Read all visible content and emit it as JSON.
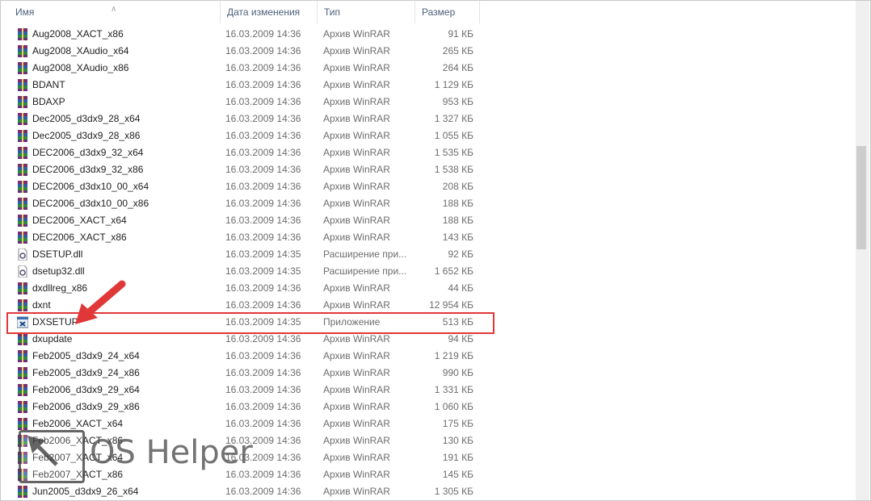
{
  "columns": {
    "name": "Имя",
    "date": "Дата изменения",
    "type": "Тип",
    "size": "Размер"
  },
  "rows": [
    {
      "name": "Aug2008_XACT_x86",
      "date": "16.03.2009 14:36",
      "type": "Архив WinRAR",
      "size": "91 КБ",
      "icon": "winrar-archive-icon"
    },
    {
      "name": "Aug2008_XAudio_x64",
      "date": "16.03.2009 14:36",
      "type": "Архив WinRAR",
      "size": "265 КБ",
      "icon": "winrar-archive-icon"
    },
    {
      "name": "Aug2008_XAudio_x86",
      "date": "16.03.2009 14:36",
      "type": "Архив WinRAR",
      "size": "264 КБ",
      "icon": "winrar-archive-icon"
    },
    {
      "name": "BDANT",
      "date": "16.03.2009 14:36",
      "type": "Архив WinRAR",
      "size": "1 129 КБ",
      "icon": "winrar-archive-icon"
    },
    {
      "name": "BDAXP",
      "date": "16.03.2009 14:36",
      "type": "Архив WinRAR",
      "size": "953 КБ",
      "icon": "winrar-archive-icon"
    },
    {
      "name": "Dec2005_d3dx9_28_x64",
      "date": "16.03.2009 14:36",
      "type": "Архив WinRAR",
      "size": "1 327 КБ",
      "icon": "winrar-archive-icon"
    },
    {
      "name": "Dec2005_d3dx9_28_x86",
      "date": "16.03.2009 14:36",
      "type": "Архив WinRAR",
      "size": "1 055 КБ",
      "icon": "winrar-archive-icon"
    },
    {
      "name": "DEC2006_d3dx9_32_x64",
      "date": "16.03.2009 14:36",
      "type": "Архив WinRAR",
      "size": "1 535 КБ",
      "icon": "winrar-archive-icon"
    },
    {
      "name": "DEC2006_d3dx9_32_x86",
      "date": "16.03.2009 14:36",
      "type": "Архив WinRAR",
      "size": "1 538 КБ",
      "icon": "winrar-archive-icon"
    },
    {
      "name": "DEC2006_d3dx10_00_x64",
      "date": "16.03.2009 14:36",
      "type": "Архив WinRAR",
      "size": "208 КБ",
      "icon": "winrar-archive-icon"
    },
    {
      "name": "DEC2006_d3dx10_00_x86",
      "date": "16.03.2009 14:36",
      "type": "Архив WinRAR",
      "size": "188 КБ",
      "icon": "winrar-archive-icon"
    },
    {
      "name": "DEC2006_XACT_x64",
      "date": "16.03.2009 14:36",
      "type": "Архив WinRAR",
      "size": "188 КБ",
      "icon": "winrar-archive-icon"
    },
    {
      "name": "DEC2006_XACT_x86",
      "date": "16.03.2009 14:36",
      "type": "Архив WinRAR",
      "size": "143 КБ",
      "icon": "winrar-archive-icon"
    },
    {
      "name": "DSETUP.dll",
      "date": "16.03.2009 14:35",
      "type": "Расширение при...",
      "size": "92 КБ",
      "icon": "dll-file-icon"
    },
    {
      "name": "dsetup32.dll",
      "date": "16.03.2009 14:35",
      "type": "Расширение при...",
      "size": "1 652 КБ",
      "icon": "dll-file-icon"
    },
    {
      "name": "dxdllreg_x86",
      "date": "16.03.2009 14:36",
      "type": "Архив WinRAR",
      "size": "44 КБ",
      "icon": "winrar-archive-icon"
    },
    {
      "name": "dxnt",
      "date": "16.03.2009 14:36",
      "type": "Архив WinRAR",
      "size": "12 954 КБ",
      "icon": "winrar-archive-icon"
    },
    {
      "name": "DXSETUP",
      "date": "16.03.2009 14:35",
      "type": "Приложение",
      "size": "513 КБ",
      "icon": "application-icon"
    },
    {
      "name": "dxupdate",
      "date": "16.03.2009 14:36",
      "type": "Архив WinRAR",
      "size": "94 КБ",
      "icon": "winrar-archive-icon"
    },
    {
      "name": "Feb2005_d3dx9_24_x64",
      "date": "16.03.2009 14:36",
      "type": "Архив WinRAR",
      "size": "1 219 КБ",
      "icon": "winrar-archive-icon"
    },
    {
      "name": "Feb2005_d3dx9_24_x86",
      "date": "16.03.2009 14:36",
      "type": "Архив WinRAR",
      "size": "990 КБ",
      "icon": "winrar-archive-icon"
    },
    {
      "name": "Feb2006_d3dx9_29_x64",
      "date": "16.03.2009 14:36",
      "type": "Архив WinRAR",
      "size": "1 331 КБ",
      "icon": "winrar-archive-icon"
    },
    {
      "name": "Feb2006_d3dx9_29_x86",
      "date": "16.03.2009 14:36",
      "type": "Архив WinRAR",
      "size": "1 060 КБ",
      "icon": "winrar-archive-icon"
    },
    {
      "name": "Feb2006_XACT_x64",
      "date": "16.03.2009 14:36",
      "type": "Архив WinRAR",
      "size": "175 КБ",
      "icon": "winrar-archive-icon"
    },
    {
      "name": "Feb2006_XACT_x86",
      "date": "16.03.2009 14:36",
      "type": "Архив WinRAR",
      "size": "130 КБ",
      "icon": "winrar-archive-icon"
    },
    {
      "name": "Feb2007_XACT_x64",
      "date": "16.03.2009 14:36",
      "type": "Архив WinRAR",
      "size": "191 КБ",
      "icon": "winrar-archive-icon"
    },
    {
      "name": "Feb2007_XACT_x86",
      "date": "16.03.2009 14:36",
      "type": "Архив WinRAR",
      "size": "145 КБ",
      "icon": "winrar-archive-icon"
    },
    {
      "name": "Jun2005_d3dx9_26_x64",
      "date": "16.03.2009 14:36",
      "type": "Архив WinRAR",
      "size": "1 305 КБ",
      "icon": "winrar-archive-icon"
    }
  ],
  "highlighted_row": "DXSETUP",
  "watermark": {
    "logo_text": "OS Helper"
  },
  "colors": {
    "highlight": "#e03838",
    "header_text": "#4c607a"
  }
}
